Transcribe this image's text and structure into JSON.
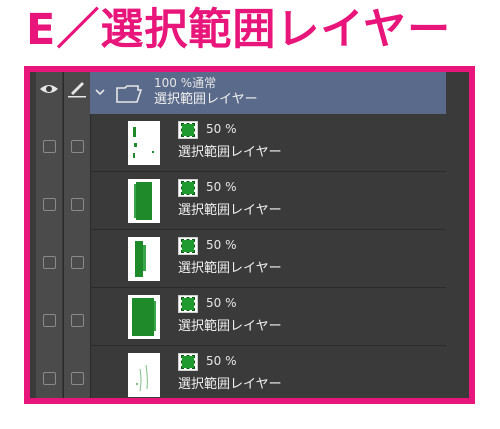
{
  "title": "E／選択範囲レイヤー",
  "colors": {
    "accent": "#e8157a",
    "panel_bg": "#3a3a3a",
    "folder_bg": "#5a6a8a",
    "selection_green": "#1f9a2e"
  },
  "header": {
    "eye_icon": "eye-icon",
    "pen_icon": "pen-icon"
  },
  "folder": {
    "mode": "100 %通常",
    "name": "選択範囲レイヤー",
    "expanded": true
  },
  "layers": [
    {
      "opacity": "50 %",
      "name": "選択範囲レイヤー"
    },
    {
      "opacity": "50 %",
      "name": "選択範囲レイヤー"
    },
    {
      "opacity": "50 %",
      "name": "選択範囲レイヤー"
    },
    {
      "opacity": "50 %",
      "name": "選択範囲レイヤー"
    },
    {
      "opacity": "50 %",
      "name": "選択範囲レイヤー"
    }
  ]
}
